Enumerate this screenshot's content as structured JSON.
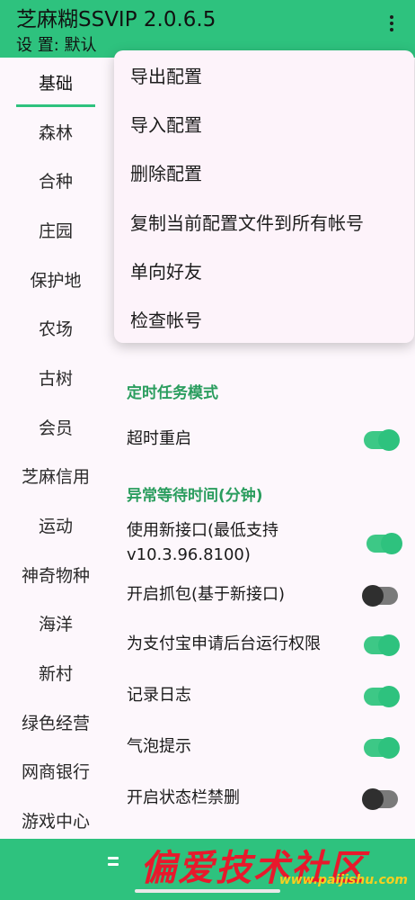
{
  "appbar": {
    "title": "芝麻糊SSVIP 2.0.6.5",
    "subtitle": "设 置: 默认"
  },
  "sidebar": {
    "items": [
      {
        "label": "基础",
        "active": true
      },
      {
        "label": "森林"
      },
      {
        "label": "合种"
      },
      {
        "label": "庄园"
      },
      {
        "label": "保护地"
      },
      {
        "label": "农场"
      },
      {
        "label": "古树"
      },
      {
        "label": "会员"
      },
      {
        "label": "芝麻信用"
      },
      {
        "label": "运动"
      },
      {
        "label": "神奇物种"
      },
      {
        "label": "海洋"
      },
      {
        "label": "新村"
      },
      {
        "label": "绿色经营"
      },
      {
        "label": "网商银行"
      },
      {
        "label": "游戏中心"
      }
    ]
  },
  "content": {
    "sections": {
      "timer_mode": "定时任务模式",
      "abnormal_wait": "异常等待时间(分钟)"
    },
    "settings": [
      {
        "label": "超时重启",
        "on": true
      },
      {
        "label": "使用新接口(最低支持v10.3.96.8100)",
        "on": true
      },
      {
        "label": "开启抓包(基于新接口)",
        "on": false
      },
      {
        "label": "为支付宝申请后台运行权限",
        "on": true
      },
      {
        "label": "记录日志",
        "on": true
      },
      {
        "label": "气泡提示",
        "on": true
      },
      {
        "label": "开启状态栏禁删",
        "on": false
      }
    ]
  },
  "menu": {
    "items": [
      "导出配置",
      "导入配置",
      "删除配置",
      "复制当前配置文件到所有帐号",
      "单向好友",
      "检查帐号"
    ]
  },
  "watermark": {
    "text": "偏爱技术社区",
    "url": "www.paijishu.com"
  },
  "colors": {
    "accent": "#2ec27e",
    "section": "#2a9d5e",
    "watermark": "#e8192c"
  }
}
